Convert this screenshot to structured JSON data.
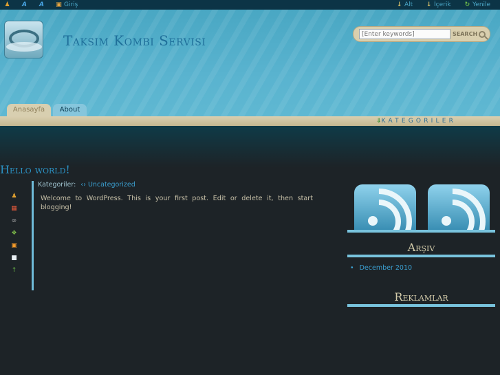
{
  "topbar": {
    "items_left": [
      {
        "icon": "user-icon"
      },
      {
        "icon": "text-a-icon"
      },
      {
        "icon": "text-a-add-icon"
      },
      {
        "icon": "login-icon",
        "label": "Giriş"
      }
    ],
    "items_right": [
      {
        "icon": "arrow-down-icon",
        "label": "Alt"
      },
      {
        "icon": "arrow-down-icon",
        "label": "İçerik"
      },
      {
        "icon": "refresh-icon",
        "label": "Yenile"
      }
    ]
  },
  "header": {
    "site_title": "Taksim Kombi Servisi",
    "search": {
      "placeholder": "[Enter keywords]",
      "button_label": "SEARCH"
    },
    "tabs": [
      {
        "label": "Anasayfa",
        "active": true
      },
      {
        "label": "About",
        "active": false
      }
    ],
    "categories_label": "KATEGORILER"
  },
  "post": {
    "title": "Hello world!",
    "categories_prefix": "Kategoriler:",
    "category": "Uncategorized",
    "body": "Welcome to WordPress. This is your first post. Edit or delete it, then start blogging!",
    "meta_icons": [
      "author-icon",
      "calendar-icon",
      "permalink-icon",
      "tags-icon",
      "rss-icon",
      "comment-icon",
      "top-icon"
    ]
  },
  "sidebar": {
    "feeds": [
      {
        "icon": "rss-feed-icon"
      },
      {
        "icon": "rss-feed-icon"
      }
    ],
    "archive_title": "Arşiv",
    "archive_items": [
      "December 2010"
    ],
    "ads_title": "Reklamlar"
  },
  "colors": {
    "background": "#1d2327",
    "header_blue": "#59b3cf",
    "link_blue": "#3b9fd0",
    "title_blue": "#1f6f9a",
    "tan": "#d9cfb0",
    "rule": "#78c3dd"
  }
}
